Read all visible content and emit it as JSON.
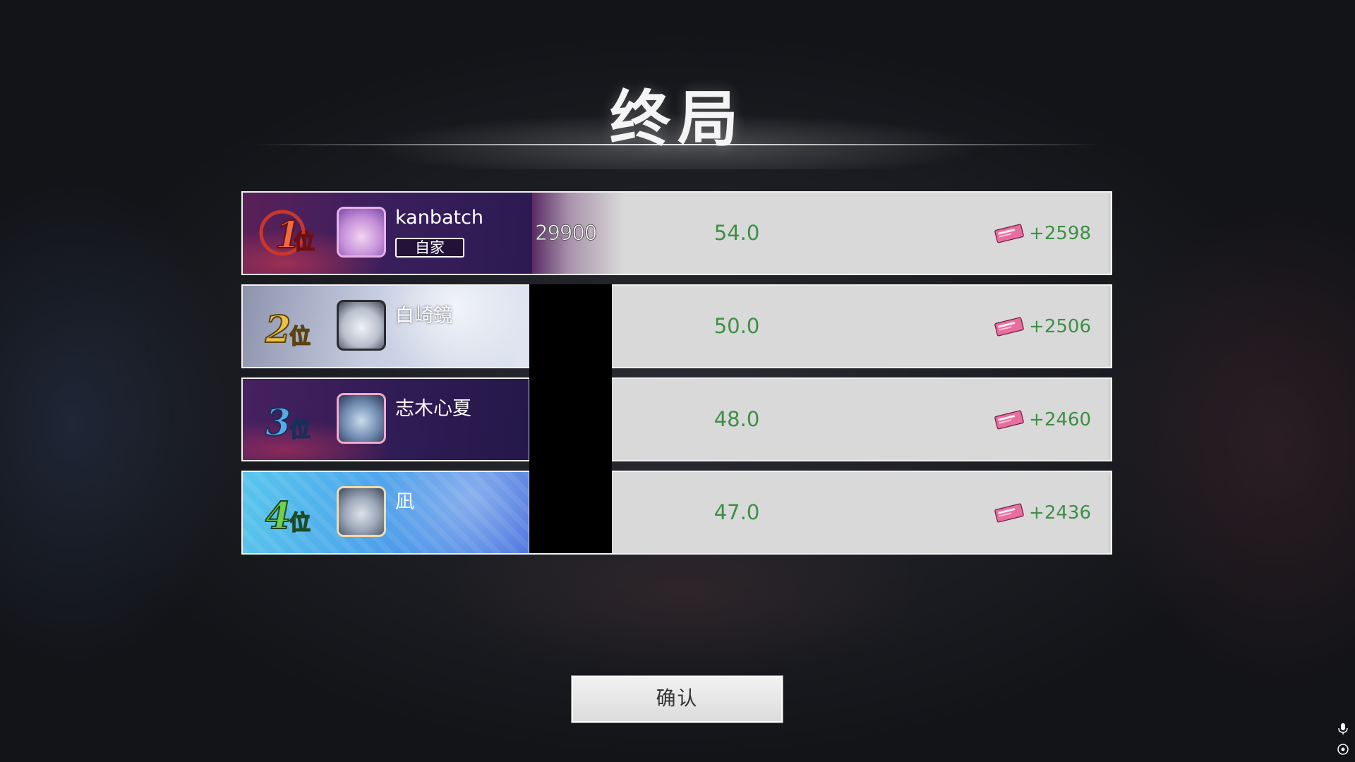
{
  "title": "终局",
  "players": [
    {
      "rank_label": "1位",
      "rank_digit": "1",
      "rank_suffix": "位",
      "rank_color": "#c8372e",
      "name": "kanbatch",
      "badge": "自家",
      "points": "29900",
      "score": "54.0",
      "delta": "+2598"
    },
    {
      "rank_label": "2位",
      "rank_digit": "2",
      "rank_suffix": "位",
      "rank_color": "#d9a93a",
      "name": "白崎鏡",
      "score": "50.0",
      "delta": "+2506"
    },
    {
      "rank_label": "3位",
      "rank_digit": "3",
      "rank_suffix": "位",
      "rank_color": "#4a9ad6",
      "name": "志木心夏",
      "score": "48.0",
      "delta": "+2460"
    },
    {
      "rank_label": "4位",
      "rank_digit": "4",
      "rank_suffix": "位",
      "rank_color": "#5fbf4a",
      "name": "凪",
      "score": "47.0",
      "delta": "+2436"
    }
  ],
  "confirm_label": "确认",
  "icons": {
    "reward": "ticket-icon",
    "system": [
      "microphone-icon",
      "target-icon"
    ]
  },
  "colors": {
    "score_green": "#3d8f45",
    "row_bg": "#d9d9d9"
  }
}
